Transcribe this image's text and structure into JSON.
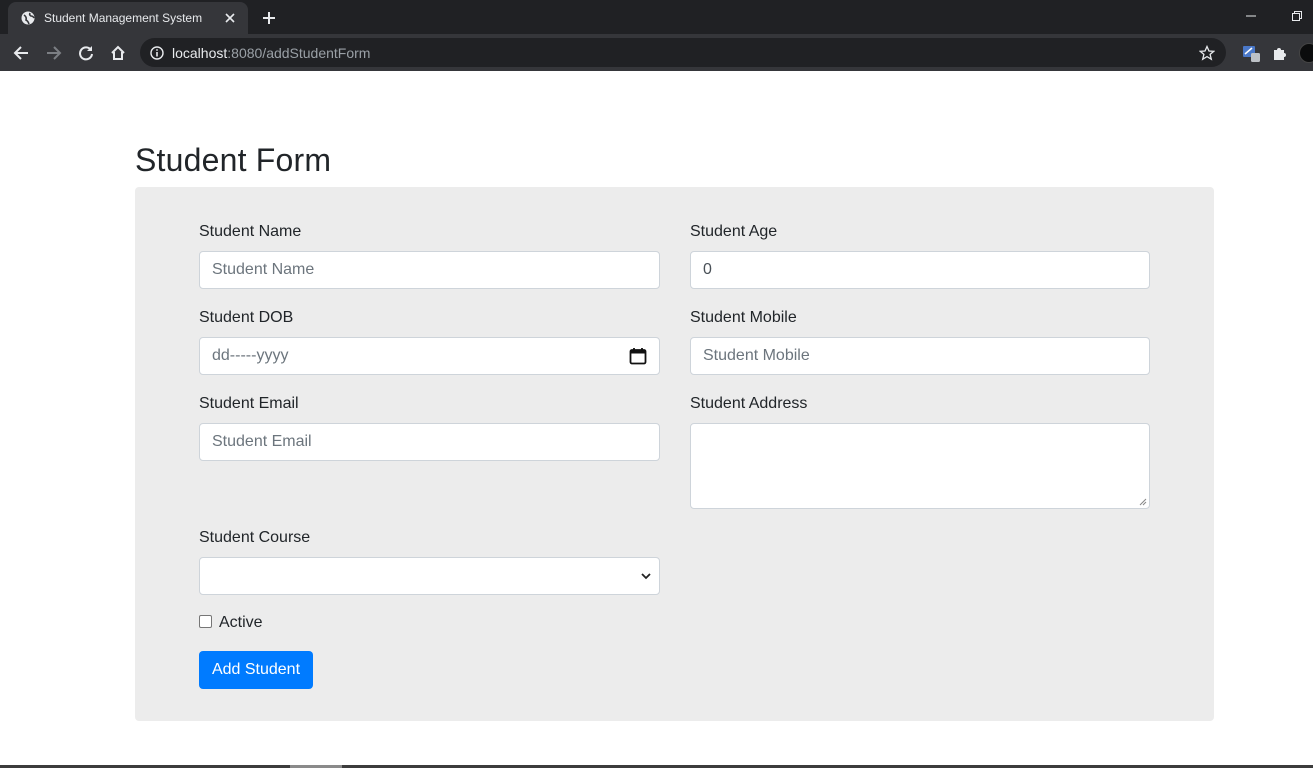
{
  "browser": {
    "tab_title": "Student Management System",
    "url_host": "localhost",
    "url_rest": ":8080/addStudentForm"
  },
  "page": {
    "title": "Student Form"
  },
  "form": {
    "name_label": "Student Name",
    "name_placeholder": "Student Name",
    "age_label": "Student Age",
    "age_value": "0",
    "dob_label": "Student DOB",
    "dob_placeholder": "dd-----yyyy",
    "mobile_label": "Student Mobile",
    "mobile_placeholder": "Student Mobile",
    "email_label": "Student Email",
    "email_placeholder": "Student Email",
    "address_label": "Student Address",
    "address_value": "",
    "course_label": "Student Course",
    "course_selected": "",
    "active_label": "Active",
    "active_checked": false,
    "submit_label": "Add Student"
  },
  "colors": {
    "accent": "#007bff",
    "panel_bg": "#ececec",
    "chrome_dark": "#202124",
    "chrome_toolbar": "#35363a"
  },
  "icons": [
    "globe-icon",
    "close-icon",
    "plus-icon",
    "minimize-icon",
    "restore-icon",
    "back-icon",
    "forward-icon",
    "reload-icon",
    "home-icon",
    "info-icon",
    "star-icon",
    "extension-icon",
    "puzzle-icon",
    "calendar-icon",
    "chevron-down-icon"
  ]
}
